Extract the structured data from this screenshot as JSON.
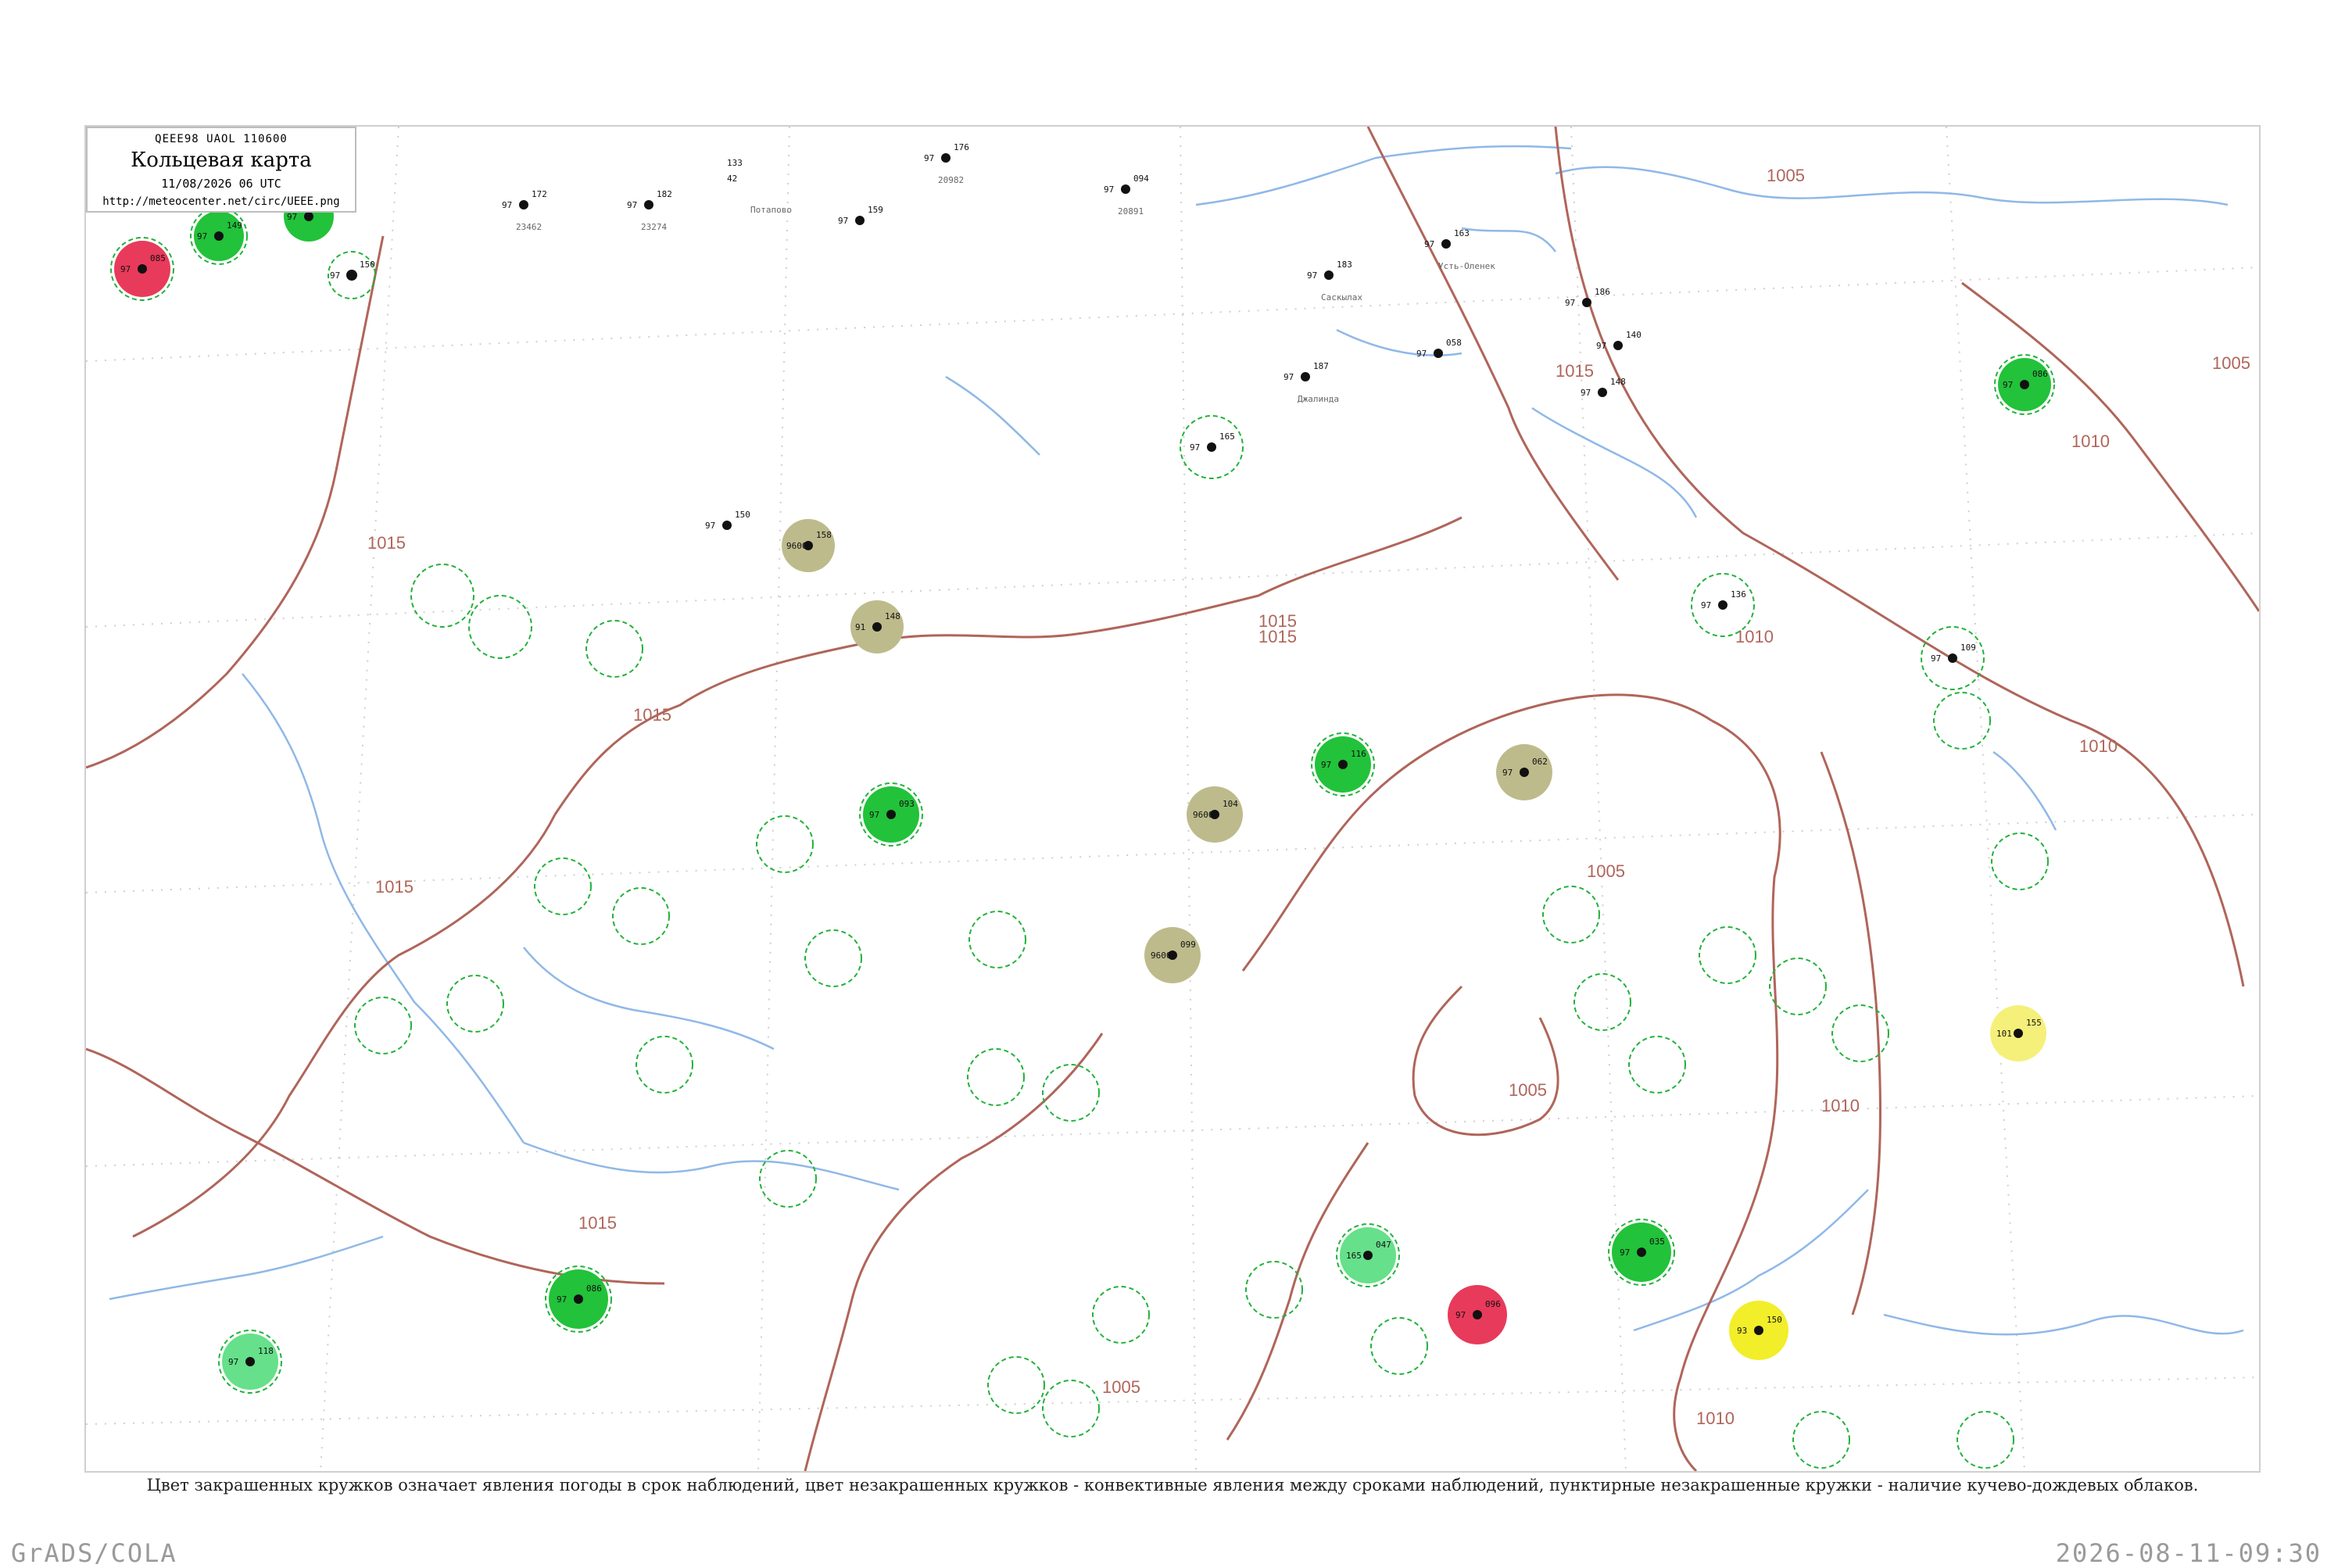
{
  "header": {
    "code_line": "QEEE98  UAOL  110600",
    "title": "Кольцевая карта",
    "datetime": "11/08/2026 06 UTC",
    "url": "http://meteocenter.net/circ/UEEE.png"
  },
  "caption": "Цвет закрашенных кружков означает явления погоды в срок наблюдений, цвет незакрашенных кружков - конвективные явления между сроками наблюдений, пунктирные незакрашенные кружки - наличие кучево-дождевых облаков.",
  "footer": {
    "left": "GrADS/COLA",
    "right": "2026-08-11-09:30"
  },
  "colors": {
    "isobar": "#b0655a",
    "river": "#8fb8e8",
    "rain_fill": "#22c23a",
    "dashed_ring": "#22b23a",
    "thunder_fill": "#e83a5a",
    "haze_fill": "#bdbb8c",
    "fog_fill": "#f2ee2a",
    "drizzle_fill": "#66e08a"
  },
  "isobar_labels": [
    {
      "label": "1005"
    },
    {
      "label": "1005"
    },
    {
      "label": "1010"
    },
    {
      "label": "1015"
    },
    {
      "label": "1015"
    },
    {
      "label": "1015"
    },
    {
      "label": "1015"
    },
    {
      "label": "1015"
    },
    {
      "label": "1010"
    },
    {
      "label": "1005"
    },
    {
      "label": "1005"
    },
    {
      "label": "1010"
    },
    {
      "label": "1010"
    },
    {
      "label": "1015"
    },
    {
      "label": "1005"
    },
    {
      "label": "1010"
    },
    {
      "label": "1015"
    }
  ],
  "stations": [
    {
      "p": "150",
      "t": "97",
      "name": "",
      "kind": "ring"
    },
    {
      "p": "172",
      "t": "97",
      "name": "23462",
      "kind": "none"
    },
    {
      "p": "182",
      "t": "97",
      "name": "23274",
      "kind": "none"
    },
    {
      "p": "133",
      "t": "42",
      "name": "Потапово",
      "kind": "none"
    },
    {
      "p": "176",
      "t": "97",
      "name": "20982",
      "kind": "none"
    },
    {
      "p": "094",
      "t": "97",
      "name": "20891",
      "kind": "none"
    },
    {
      "p": "149",
      "t": "97",
      "name": "",
      "kind": "rain"
    },
    {
      "p": "133",
      "t": "97",
      "name": "",
      "kind": "rain"
    },
    {
      "p": "085",
      "t": "97",
      "name": "",
      "kind": "thunder"
    },
    {
      "p": "163",
      "t": "97",
      "name": "Усть-Оленек",
      "kind": "none"
    },
    {
      "p": "183",
      "t": "97",
      "name": "Саскылах",
      "kind": "none"
    },
    {
      "p": "186",
      "t": "97",
      "name": "",
      "kind": "none"
    },
    {
      "p": "140",
      "t": "97",
      "name": "",
      "kind": "none"
    },
    {
      "p": "148",
      "t": "97",
      "name": "",
      "kind": "none"
    },
    {
      "p": "086",
      "t": "97",
      "name": "",
      "kind": "rain"
    },
    {
      "p": "159",
      "t": "97",
      "name": "",
      "kind": "none"
    },
    {
      "p": "187",
      "t": "97",
      "name": "Джалинда",
      "kind": "none"
    },
    {
      "p": "058",
      "t": "97",
      "name": "",
      "kind": "none"
    },
    {
      "p": "165",
      "t": "97",
      "name": "",
      "kind": "ring"
    },
    {
      "p": "150",
      "t": "97",
      "name": "",
      "kind": "none"
    },
    {
      "p": "158",
      "t": "9600",
      "name": "",
      "kind": "haze"
    },
    {
      "p": "148",
      "t": "91",
      "name": "",
      "kind": "haze"
    },
    {
      "p": "136",
      "t": "97",
      "name": "",
      "kind": "ring"
    },
    {
      "p": "109",
      "t": "97",
      "name": "",
      "kind": "ring"
    },
    {
      "p": "062",
      "t": "97",
      "name": "",
      "kind": "haze"
    },
    {
      "p": "116",
      "t": "97",
      "name": "",
      "kind": "rain"
    },
    {
      "p": "104",
      "t": "9600",
      "name": "",
      "kind": "haze"
    },
    {
      "p": "093",
      "t": "97",
      "name": "",
      "kind": "rain"
    },
    {
      "p": "099",
      "t": "9600",
      "name": "",
      "kind": "haze"
    },
    {
      "p": "155",
      "t": "101",
      "name": "",
      "kind": "fog"
    },
    {
      "p": "150",
      "t": "93",
      "name": "",
      "kind": "fog"
    },
    {
      "p": "035",
      "t": "97",
      "name": "",
      "kind": "rain"
    },
    {
      "p": "047",
      "t": "165",
      "name": "",
      "kind": "drizzle"
    },
    {
      "p": "118",
      "t": "97",
      "name": "",
      "kind": "drizzle"
    },
    {
      "p": "086",
      "t": "97",
      "name": "",
      "kind": "rain"
    },
    {
      "p": "096",
      "t": "97",
      "name": "",
      "kind": "thunder"
    }
  ]
}
